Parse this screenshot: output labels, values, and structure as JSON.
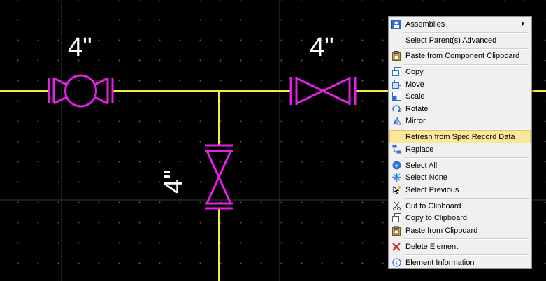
{
  "canvas": {
    "line_color": "#f5e94b",
    "valve_color": "#e61fe6",
    "text_color": "#ffffff",
    "dimension_labels": [
      "4\"",
      "4\"",
      "4\""
    ]
  },
  "menu": {
    "highlight_color": "#fbe79b",
    "items": [
      {
        "label": "Assemblies",
        "icon": "assemblies-icon",
        "submenu": true
      },
      {
        "label": "Select Parent(s) Advanced",
        "icon": ""
      },
      {
        "label": "Paste from Component Clipboard",
        "icon": "paste-icon"
      },
      {
        "label": "Copy",
        "icon": "copy-icon"
      },
      {
        "label": "Move",
        "icon": "move-icon"
      },
      {
        "label": "Scale",
        "icon": "scale-icon"
      },
      {
        "label": "Rotate",
        "icon": "rotate-icon"
      },
      {
        "label": "Mirror",
        "icon": "mirror-icon"
      },
      {
        "label": "Refresh from Spec Record Data",
        "icon": "",
        "highlighted": true
      },
      {
        "label": "Replace",
        "icon": "replace-icon"
      },
      {
        "label": "Select All",
        "icon": "select-all-icon"
      },
      {
        "label": "Select None",
        "icon": "select-none-icon"
      },
      {
        "label": "Select Previous",
        "icon": "select-previous-icon"
      },
      {
        "label": "Cut to Clipboard",
        "icon": "cut-icon"
      },
      {
        "label": "Copy to Clipboard",
        "icon": "copy-clipboard-icon"
      },
      {
        "label": "Paste from Clipboard",
        "icon": "paste-clipboard-icon"
      },
      {
        "label": "Delete Element",
        "icon": "delete-icon"
      },
      {
        "label": "Element Information",
        "icon": "info-icon"
      }
    ]
  }
}
